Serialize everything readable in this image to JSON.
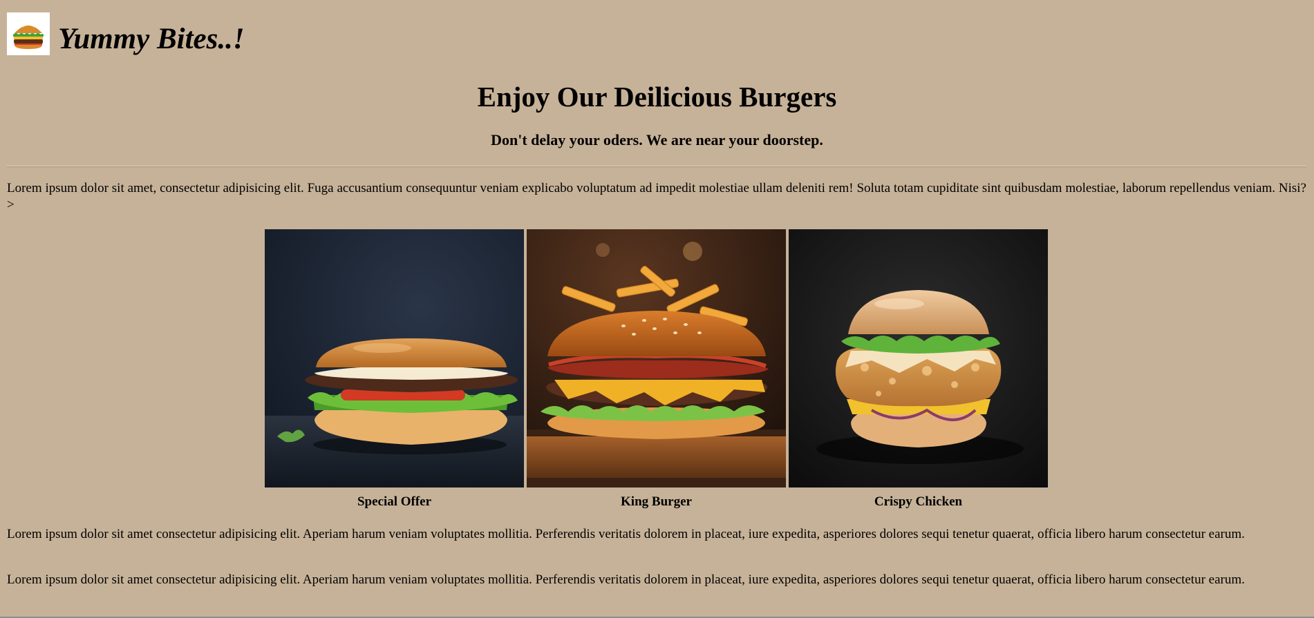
{
  "header": {
    "logo_icon": "burger-logo-icon",
    "brand_title": "Yummy Bites..!"
  },
  "hero": {
    "headline": "Enjoy Our Deilicious Burgers",
    "subheadline": "Don't delay your oders. We are near your doorstep."
  },
  "intro_text": "Lorem ipsum dolor sit amet, consectetur adipisicing elit. Fuga accusantium consequuntur veniam explicabo voluptatum ad impedit molestiae ullam deleniti rem! Soluta totam cupiditate sint quibusdam molestiae, laborum repellendus veniam. Nisi?>",
  "gallery": [
    {
      "caption": "Special Offer",
      "image_icon": "cheeseburger-photo"
    },
    {
      "caption": "King Burger",
      "image_icon": "bacon-burger-fries-photo"
    },
    {
      "caption": "Crispy Chicken",
      "image_icon": "crispy-chicken-burger-photo"
    }
  ],
  "paragraphs": [
    "Lorem ipsum dolor sit amet consectetur adipisicing elit. Aperiam harum veniam voluptates mollitia. Perferendis veritatis dolorem in placeat, iure expedita, asperiores dolores sequi tenetur quaerat, officia libero harum consectetur earum.",
    "Lorem ipsum dolor sit amet consectetur adipisicing elit. Aperiam harum veniam voluptates mollitia. Perferendis veritatis dolorem in placeat, iure expedita, asperiores dolores sequi tenetur quaerat, officia libero harum consectetur earum."
  ],
  "colors": {
    "background": "#c6b298",
    "text": "#000000"
  }
}
